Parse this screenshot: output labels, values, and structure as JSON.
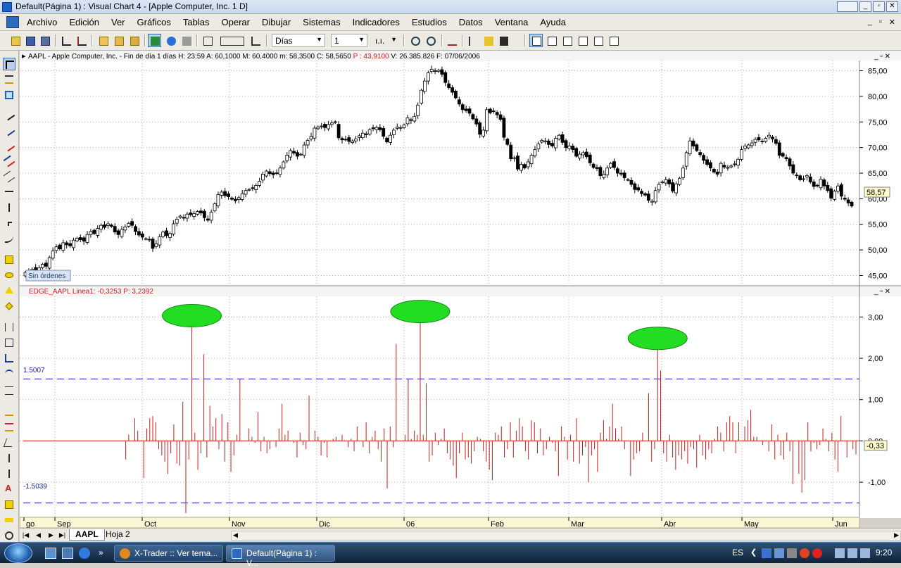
{
  "window": {
    "title": "Default(Página 1) : Visual Chart 4 - [Apple Computer, Inc. 1 D]"
  },
  "menu": {
    "items": [
      "Archivo",
      "Edición",
      "Ver",
      "Gráficos",
      "Tablas",
      "Operar",
      "Dibujar",
      "Sistemas",
      "Indicadores",
      "Estudios",
      "Datos",
      "Ventana",
      "Ayuda"
    ],
    "mdi_controls": [
      "_",
      "▫",
      "✕"
    ]
  },
  "toolbar": {
    "period_select": "Días",
    "period_number": "1",
    "style_select": "ı.ı."
  },
  "price_panel": {
    "header": "AAPL - Apple Computer, Inc. - Fin de día 1 días  H: 23:59  A: 60,1000  M: 60,4000  m: 58,3500  C: 58,5650",
    "header_p": "P : 43,9100",
    "header_v": "V: 26.385.826  F: 07/06/2006",
    "orders_label": "Sin órdenes",
    "last_price_badge": "58,57",
    "y_ticks": [
      "85,00",
      "80,00",
      "75,00",
      "70,00",
      "65,00",
      "60,00",
      "55,00",
      "50,00",
      "45,00"
    ],
    "y_min": 43,
    "y_max": 87
  },
  "indicator_panel": {
    "header": "EDGE_AAPL  Linea1: -0,3253",
    "header_p": "P: 3,2392",
    "upper_level_label": "1.5007",
    "lower_level_label": "-1.5039",
    "upper_level": 1.5007,
    "lower_level": -1.5039,
    "last_value_badge": "-0,33",
    "y_ticks": [
      "3,00",
      "2,00",
      "1,00",
      "0,00",
      "-1,00"
    ],
    "y_min": -1.85,
    "y_max": 3.5
  },
  "x_axis": {
    "month_labels": [
      "go",
      "Sep",
      "Oct",
      "Nov",
      "Dic",
      "06",
      "Feb",
      "Mar",
      "Abr",
      "May",
      "Jun"
    ]
  },
  "sheets": {
    "tabs": [
      "AAPL",
      "Hoja 2"
    ],
    "active": "AAPL"
  },
  "taskbar": {
    "items": [
      "X-Trader :: Ver tema...",
      "Default(Página 1) : V..."
    ],
    "language": "ES",
    "clock": "9:20"
  },
  "colors": {
    "indicator": "#c81e1e",
    "level_line": "#1a1aa6",
    "ellipse": "#22dd22",
    "badge": "#ffffcc",
    "grid": "#b0b0b0"
  },
  "chart_data": [
    {
      "type": "candlestick",
      "title": "AAPL - Apple Computer, Inc. - Fin de día 1 días",
      "ylim": [
        43,
        87
      ],
      "close": [
        45.6,
        45.8,
        46.2,
        45.9,
        46.5,
        47.2,
        46.8,
        48.5,
        49.8,
        50.6,
        50.2,
        51.4,
        51.0,
        50.8,
        51.9,
        52.3,
        52.0,
        51.7,
        53.0,
        53.6,
        53.2,
        54.2,
        54.8,
        54.4,
        55.1,
        54.6,
        53.5,
        53.0,
        54.0,
        54.5,
        55.2,
        54.8,
        53.6,
        52.9,
        52.5,
        52.2,
        52.0,
        50.3,
        51.2,
        52.6,
        53.5,
        52.8,
        53.2,
        55.1,
        56.0,
        56.6,
        56.2,
        57.0,
        56.9,
        57.1,
        57.5,
        57.2,
        56.3,
        55.8,
        57.4,
        59.0,
        60.8,
        61.3,
        60.6,
        60.4,
        59.9,
        59.6,
        60.2,
        61.0,
        61.6,
        61.8,
        62.0,
        62.6,
        63.4,
        64.8,
        65.4,
        64.9,
        64.7,
        65.0,
        66.0,
        67.2,
        68.5,
        69.4,
        68.9,
        68.3,
        68.7,
        70.5,
        71.4,
        72.2,
        73.8,
        74.0,
        74.2,
        73.9,
        74.5,
        74.8,
        74.9,
        71.9,
        71.5,
        71.6,
        71.2,
        71.3,
        71.7,
        72.3,
        72.8,
        72.5,
        73.5,
        73.7,
        73.9,
        73.5,
        72.2,
        71.1,
        72.4,
        73.4,
        74.0,
        73.9,
        74.4,
        75.8,
        75.3,
        76.1,
        78.3,
        81.2,
        83.0,
        84.6,
        85.3,
        85.0,
        85.1,
        84.3,
        82.7,
        81.7,
        80.8,
        79.7,
        78.5,
        77.4,
        77.2,
        76.7,
        75.6,
        74.6,
        72.6,
        73.4,
        77.4,
        76.8,
        77.1,
        76.4,
        75.5,
        72.0,
        70.6,
        67.8,
        68.0,
        65.8,
        66.7,
        66.0,
        67.2,
        68.5,
        69.6,
        70.7,
        71.4,
        71.3,
        70.6,
        70.3,
        71.8,
        72.4,
        71.0,
        70.0,
        70.3,
        69.6,
        68.3,
        68.7,
        69.0,
        68.2,
        67.0,
        66.1,
        65.9,
        64.5,
        64.8,
        66.0,
        66.9,
        66.1,
        65.0,
        64.8,
        64.1,
        63.7,
        62.8,
        61.8,
        61.7,
        61.0,
        60.7,
        59.7,
        59.5,
        61.6,
        62.8,
        63.3,
        63.7,
        62.9,
        61.5,
        62.9,
        64.0,
        66.0,
        69.0,
        71.3,
        70.3,
        69.4,
        68.6,
        67.5,
        66.7,
        66.0,
        65.2,
        64.8,
        66.9,
        66.2,
        66.1,
        66.4,
        66.8,
        67.7,
        69.6,
        70.3,
        70.5,
        70.9,
        71.6,
        71.5,
        71.2,
        71.8,
        72.4,
        71.7,
        70.8,
        68.5,
        68.3,
        67.8,
        66.4,
        65.0,
        64.6,
        63.7,
        63.9,
        64.5,
        63.3,
        62.4,
        62.5,
        63.8,
        62.5,
        61.6,
        60.1,
        61.5,
        62.5,
        60.5,
        59.9,
        59.2,
        58.57
      ]
    },
    {
      "type": "bar",
      "title": "EDGE_AAPL",
      "ylim": [
        -1.85,
        3.5
      ],
      "levels": [
        1.5007,
        -1.5039
      ],
      "values": [
        0.0,
        0.0,
        0.0,
        0.0,
        0.0,
        0.0,
        0.0,
        0.0,
        0.0,
        0.0,
        0.0,
        0.0,
        0.0,
        0.0,
        0.0,
        0.0,
        0.0,
        0.0,
        0.0,
        0.0,
        0.0,
        0.0,
        0.0,
        0.0,
        0.0,
        0.0,
        0.0,
        0.0,
        0.0,
        0.0,
        0.0,
        0.0,
        -0.45,
        0.15,
        0.0,
        0.55,
        0.25,
        0.0,
        -0.9,
        0.3,
        0.55,
        0.6,
        0.45,
        -0.2,
        -0.35,
        -0.5,
        -0.8,
        -0.3,
        0.4,
        -0.55,
        -0.6,
        0.95,
        -1.75,
        -0.45,
        3.1,
        0.2,
        -0.7,
        -0.3,
        2.1,
        -0.4,
        0.85,
        0.35,
        0.55,
        -0.2,
        0.65,
        -0.5,
        0.45,
        -0.75,
        -0.35,
        0.15,
        1.5,
        0.0,
        0.0,
        0.3,
        0.1,
        -0.05,
        0.7,
        -0.25,
        0.1,
        -0.3,
        -0.2,
        0.0,
        -0.15,
        0.3,
        0.9,
        0.15,
        0.25,
        0.0,
        -0.05,
        -0.4,
        0.2,
        -0.1,
        -0.2,
        1.1,
        0.0,
        0.25,
        0.1,
        -0.35,
        -0.05,
        -0.4,
        0.0,
        0.05,
        0.1,
        0.02,
        0.15,
        0.0,
        -0.15,
        0.05,
        -0.25,
        0.35,
        0.0,
        -0.15,
        0.45,
        -0.3,
        0.1,
        0.25,
        -0.2,
        -0.5,
        0.3,
        -1.15,
        0.35,
        -0.15,
        2.35,
        0.0,
        0.0,
        0.15,
        1.5,
        0.05,
        0.25,
        0.15,
        3.2,
        0.15,
        1.4,
        -0.5,
        -0.35,
        0.2,
        -0.1,
        0.05,
        0.3,
        -0.3,
        -0.45,
        -0.6,
        -0.9,
        -0.3,
        0.2,
        -0.45,
        -0.4,
        -0.55,
        -0.25,
        0.1,
        0.05,
        -0.25,
        -0.5,
        -0.7,
        -0.95,
        0.2,
        0.15,
        0.35,
        -0.4,
        -0.2,
        0.45,
        -0.4,
        0.25,
        0.55,
        0.35,
        -0.25,
        -0.45,
        0.5,
        0.45,
        -0.3,
        0.3,
        -0.35,
        -0.2,
        0.1,
        -0.05,
        -0.25,
        -0.85,
        0.35,
        0.1,
        -0.45,
        0.15,
        -0.5,
        0.55,
        -0.55,
        -0.35,
        -0.15,
        -1.0,
        -0.35,
        -0.2,
        -0.75,
        0.2,
        0.5,
        0.05,
        0.35,
        0.9,
        0.3,
        0.05,
        0.35,
        -0.2,
        0.0,
        -0.85,
        -0.45,
        -0.3,
        -0.25,
        0.2,
        0.0,
        1.15,
        -0.5,
        -0.2,
        2.55,
        1.7,
        -0.3,
        -0.5,
        0.15,
        -0.4,
        -0.7,
        -0.35,
        -0.45,
        -0.25,
        -0.55,
        -0.15,
        -0.2,
        -0.65,
        0.15,
        -0.35,
        -0.45,
        -0.2,
        -0.3,
        0.05,
        0.35,
        0.2,
        -0.25,
        0.45,
        0.6,
        0.45,
        -0.3,
        0.45,
        0.0,
        0.35,
        0.5,
        0.75,
        0.1,
        0.1,
        0.0,
        -0.1,
        0.0,
        -0.25,
        0.4,
        -0.45,
        0.15,
        -0.35,
        -0.45,
        0.2,
        -0.25,
        -1.05,
        0.0,
        -0.8,
        -1.25,
        -0.95,
        0.45,
        -0.25,
        -0.05,
        -0.2,
        -0.1,
        0.3,
        0.05,
        -0.25,
        0.2,
        -0.45,
        -0.75,
        0.6,
        0.0,
        -0.4,
        0.0,
        -0.2,
        -0.33
      ],
      "highlighted_peaks": [
        3.1,
        3.2,
        2.55
      ]
    }
  ]
}
